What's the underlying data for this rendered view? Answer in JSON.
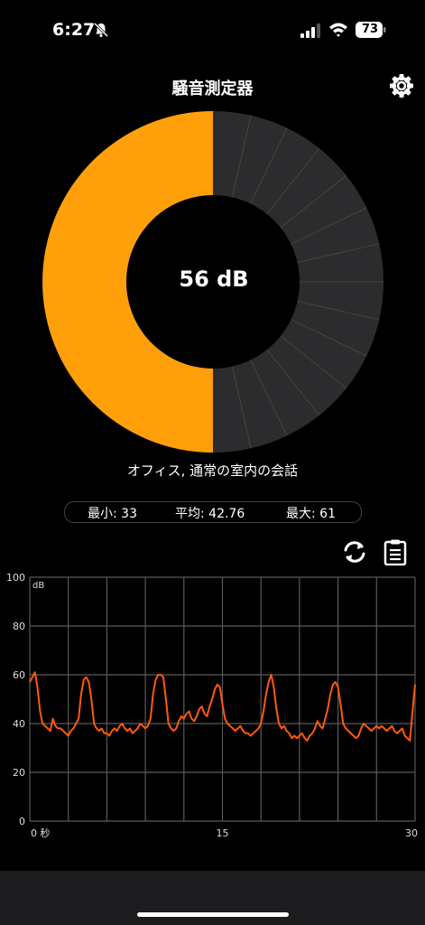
{
  "status_bar": {
    "time": "6:27",
    "battery": "73"
  },
  "app": {
    "title": "騒音測定器"
  },
  "gauge": {
    "value_text": "56 dB",
    "level_db": 56,
    "max_db": 112,
    "segments": 28,
    "fill_color": "#ff9f0a",
    "track_color": "#2c2c2e"
  },
  "category": "オフィス, 通常の室内の会話",
  "stats": {
    "min": "最小: 33",
    "avg": "平均: 42.76",
    "max": "最大: 61"
  },
  "chart_data": {
    "type": "line",
    "unit_label": "dB",
    "yticks": [
      "100",
      "80",
      "60",
      "40",
      "20",
      "0"
    ],
    "xticks": [
      "0 秒",
      "15",
      "30"
    ],
    "ylim": [
      0,
      100
    ],
    "xlim": [
      0,
      30
    ],
    "grid": true,
    "line_color": "#ff5a0a",
    "series": [
      {
        "values": [
          [
            0,
            57
          ],
          [
            0.2,
            59
          ],
          [
            0.4,
            61
          ],
          [
            0.6,
            55
          ],
          [
            0.8,
            45
          ],
          [
            1.0,
            40
          ],
          [
            1.2,
            39
          ],
          [
            1.4,
            38
          ],
          [
            1.6,
            37
          ],
          [
            1.8,
            42
          ],
          [
            2.0,
            39
          ],
          [
            2.2,
            38
          ],
          [
            2.4,
            38
          ],
          [
            2.6,
            37
          ],
          [
            2.8,
            36
          ],
          [
            3.0,
            35
          ],
          [
            3.2,
            37
          ],
          [
            3.4,
            38
          ],
          [
            3.6,
            40
          ],
          [
            3.8,
            42
          ],
          [
            4.0,
            52
          ],
          [
            4.2,
            58
          ],
          [
            4.4,
            59
          ],
          [
            4.6,
            57
          ],
          [
            4.8,
            50
          ],
          [
            5.0,
            40
          ],
          [
            5.2,
            38
          ],
          [
            5.4,
            37
          ],
          [
            5.6,
            38
          ],
          [
            5.8,
            36
          ],
          [
            6.0,
            36
          ],
          [
            6.2,
            35
          ],
          [
            6.4,
            37
          ],
          [
            6.6,
            38
          ],
          [
            6.8,
            37
          ],
          [
            7.0,
            39
          ],
          [
            7.2,
            40
          ],
          [
            7.4,
            38
          ],
          [
            7.6,
            37
          ],
          [
            7.8,
            38
          ],
          [
            8.0,
            36
          ],
          [
            8.2,
            37
          ],
          [
            8.4,
            38
          ],
          [
            8.6,
            40
          ],
          [
            8.8,
            39
          ],
          [
            9.0,
            38
          ],
          [
            9.2,
            39
          ],
          [
            9.4,
            42
          ],
          [
            9.6,
            52
          ],
          [
            9.8,
            58
          ],
          [
            10.0,
            60
          ],
          [
            10.2,
            60
          ],
          [
            10.4,
            59
          ],
          [
            10.6,
            50
          ],
          [
            10.8,
            40
          ],
          [
            11.0,
            38
          ],
          [
            11.2,
            37
          ],
          [
            11.4,
            38
          ],
          [
            11.6,
            41
          ],
          [
            11.8,
            43
          ],
          [
            12.0,
            42
          ],
          [
            12.2,
            44
          ],
          [
            12.4,
            45
          ],
          [
            12.6,
            42
          ],
          [
            12.8,
            41
          ],
          [
            13.0,
            43
          ],
          [
            13.2,
            46
          ],
          [
            13.4,
            47
          ],
          [
            13.6,
            44
          ],
          [
            13.8,
            43
          ],
          [
            14.0,
            47
          ],
          [
            14.2,
            50
          ],
          [
            14.4,
            54
          ],
          [
            14.6,
            56
          ],
          [
            14.8,
            55
          ],
          [
            15.0,
            48
          ],
          [
            15.2,
            42
          ],
          [
            15.4,
            40
          ],
          [
            15.6,
            39
          ],
          [
            15.8,
            38
          ],
          [
            16.0,
            37
          ],
          [
            16.2,
            38
          ],
          [
            16.4,
            39
          ],
          [
            16.6,
            37
          ],
          [
            16.8,
            36
          ],
          [
            17.0,
            36
          ],
          [
            17.2,
            35
          ],
          [
            17.4,
            36
          ],
          [
            17.6,
            37
          ],
          [
            17.8,
            38
          ],
          [
            18.0,
            40
          ],
          [
            18.2,
            45
          ],
          [
            18.4,
            52
          ],
          [
            18.6,
            57
          ],
          [
            18.8,
            60
          ],
          [
            19.0,
            55
          ],
          [
            19.2,
            46
          ],
          [
            19.4,
            40
          ],
          [
            19.6,
            38
          ],
          [
            19.8,
            39
          ],
          [
            20.0,
            37
          ],
          [
            20.2,
            36
          ],
          [
            20.4,
            34
          ],
          [
            20.6,
            35
          ],
          [
            20.8,
            34
          ],
          [
            21.0,
            35
          ],
          [
            21.2,
            36
          ],
          [
            21.4,
            34
          ],
          [
            21.6,
            33
          ],
          [
            21.8,
            35
          ],
          [
            22.0,
            36
          ],
          [
            22.2,
            38
          ],
          [
            22.4,
            41
          ],
          [
            22.6,
            39
          ],
          [
            22.8,
            38
          ],
          [
            23.0,
            42
          ],
          [
            23.2,
            46
          ],
          [
            23.4,
            52
          ],
          [
            23.6,
            56
          ],
          [
            23.8,
            57
          ],
          [
            24.0,
            55
          ],
          [
            24.2,
            48
          ],
          [
            24.4,
            40
          ],
          [
            24.6,
            38
          ],
          [
            24.8,
            37
          ],
          [
            25.0,
            36
          ],
          [
            25.2,
            35
          ],
          [
            25.4,
            34
          ],
          [
            25.6,
            35
          ],
          [
            25.8,
            38
          ],
          [
            26.0,
            40
          ],
          [
            26.2,
            39
          ],
          [
            26.4,
            38
          ],
          [
            26.6,
            37
          ],
          [
            26.8,
            38
          ],
          [
            27.0,
            39
          ],
          [
            27.2,
            38
          ],
          [
            27.4,
            39
          ],
          [
            27.6,
            38
          ],
          [
            27.8,
            37
          ],
          [
            28.0,
            38
          ],
          [
            28.2,
            39
          ],
          [
            28.4,
            37
          ],
          [
            28.6,
            36
          ],
          [
            28.8,
            37
          ],
          [
            29.0,
            38
          ],
          [
            29.2,
            35
          ],
          [
            29.4,
            34
          ],
          [
            29.6,
            33
          ],
          [
            29.8,
            45
          ],
          [
            30.0,
            56
          ]
        ]
      }
    ]
  },
  "icons": {
    "settings": "gear-icon",
    "refresh": "refresh-icon",
    "clipboard": "clipboard-icon",
    "bell": "bell-slash-icon"
  },
  "colors": {
    "accent": "#ff9f0a",
    "background": "#000000",
    "bottom_bar": "#1c1c1e"
  }
}
